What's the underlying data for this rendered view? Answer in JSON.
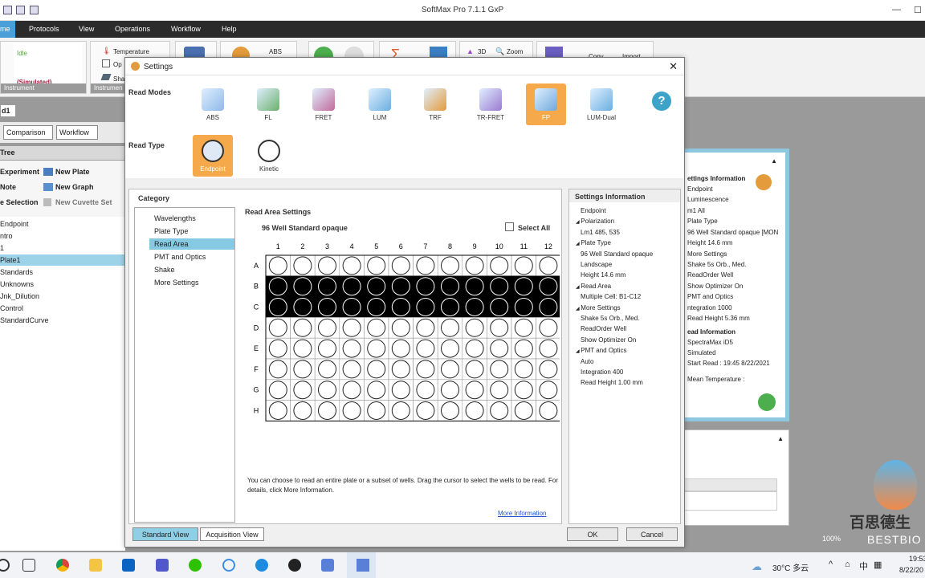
{
  "app_title": "SoftMax Pro 7.1.1 GxP",
  "menu": [
    "me",
    "Protocols",
    "View",
    "Operations",
    "Workflow",
    "Help"
  ],
  "ribbon": {
    "status": "Idle",
    "simulated": "(Simulated)",
    "instrument_label": "Instrument",
    "instrument_label2": "Instrumen",
    "temperature": "Temperature",
    "op": "Op",
    "sha": "Sha",
    "abs": "ABS",
    "three_d": "3D",
    "zoom": "Zoom",
    "copy": "Copy",
    "import": "Import"
  },
  "doc_tab": "d1",
  "left_tabs": [
    "Comparison",
    "Workflow"
  ],
  "tree": {
    "header": "Tree",
    "tools": [
      {
        "label": "Experiment",
        "icon": "experiment-icon"
      },
      {
        "label": "New Plate",
        "icon": "plate-icon"
      },
      {
        "label": "Note",
        "icon": "note-icon"
      },
      {
        "label": "New Graph",
        "icon": "graph-icon"
      },
      {
        "label": "e Selection",
        "icon": "selection-icon"
      },
      {
        "label": "New Cuvette Set",
        "icon": "cuvette-icon"
      }
    ],
    "items": [
      "Endpoint",
      "ntro",
      "1",
      "Plate1",
      "Standards",
      "Unknowns",
      "Jnk_Dilution",
      "Control",
      "StandardCurve"
    ],
    "selected": 3
  },
  "dialog": {
    "title": "Settings",
    "read_modes_label": "Read Modes",
    "read_type_label": "Read Type",
    "read_modes": [
      {
        "label": "ABS",
        "selected": false
      },
      {
        "label": "FL",
        "selected": false
      },
      {
        "label": "FRET",
        "selected": false
      },
      {
        "label": "LUM",
        "selected": false
      },
      {
        "label": "TRF",
        "selected": false
      },
      {
        "label": "TR-FRET",
        "selected": false
      },
      {
        "label": "FP",
        "selected": true
      },
      {
        "label": "LUM-Dual",
        "selected": false
      }
    ],
    "read_types": [
      {
        "label": "Endpoint",
        "selected": true
      },
      {
        "label": "Kinetic",
        "selected": false
      }
    ],
    "category_label": "Category",
    "categories": [
      "Wavelengths",
      "Plate Type",
      "Read Area",
      "PMT and Optics",
      "Shake",
      "More Settings"
    ],
    "selected_category": 2,
    "read_area_title": "Read Area Settings",
    "plate_name": "96 Well Standard opaque",
    "select_all_label": "Select All",
    "select_all_checked": false,
    "columns": [
      "1",
      "2",
      "3",
      "4",
      "5",
      "6",
      "7",
      "8",
      "9",
      "10",
      "11",
      "12"
    ],
    "rows": [
      "A",
      "B",
      "C",
      "D",
      "E",
      "F",
      "G",
      "H"
    ],
    "selected_rows": [
      "B",
      "C"
    ],
    "help_text": "You can choose to read an entire plate or a subset of wells. Drag the cursor to select the wells to be read. For details, click More Information.",
    "more_info_link": "More Information",
    "settings_info_title": "Settings Information",
    "settings_info": [
      {
        "t": "Endpoint",
        "lvl": 1
      },
      {
        "t": "Polarization",
        "lvl": 0
      },
      {
        "t": "Lm1    485, 535",
        "lvl": 2
      },
      {
        "t": "Plate Type",
        "lvl": 0
      },
      {
        "t": "96 Well Standard opaque",
        "lvl": 2
      },
      {
        "t": "Landscape",
        "lvl": 2
      },
      {
        "t": "Height  14.6 mm",
        "lvl": 2
      },
      {
        "t": "Read Area",
        "lvl": 0
      },
      {
        "t": "Multiple Cell: B1-C12",
        "lvl": 2
      },
      {
        "t": "More Settings",
        "lvl": 0
      },
      {
        "t": "Shake   5s Orb., Med.",
        "lvl": 2
      },
      {
        "t": "ReadOrder  Well",
        "lvl": 2
      },
      {
        "t": "Show Optimizer  On",
        "lvl": 2
      },
      {
        "t": "PMT and Optics",
        "lvl": 0
      },
      {
        "t": "Auto",
        "lvl": 2
      },
      {
        "t": "Integration  400",
        "lvl": 2
      },
      {
        "t": "Read Height  1.00 mm",
        "lvl": 2
      }
    ],
    "standard_view": "Standard View",
    "acquisition_view": "Acquisition View",
    "ok": "OK",
    "cancel": "Cancel"
  },
  "right_panel": [
    "ettings Information",
    "Endpoint",
    "Luminescence",
    "m1    All",
    "Plate Type",
    "96 Well Standard opaque [MON",
    "Height  14.6 mm",
    "More Settings",
    "Shake   5s Orb., Med.",
    "ReadOrder  Well",
    "Show Optimizer  On",
    "PMT and Optics",
    "ntegration  1000",
    "Read Height  5.36 mm",
    "ead Information",
    "SpectraMax iD5",
    "Simulated",
    "Start Read : 19:45 8/22/2021",
    "Mean Temperature :"
  ],
  "zoom_level": "100%",
  "taskbar": {
    "weather": "30°C  多云",
    "ime": "中",
    "time": "19:53",
    "date": "8/22/20"
  },
  "watermark": {
    "cn": "百思德生",
    "en": "BESTBIO"
  }
}
